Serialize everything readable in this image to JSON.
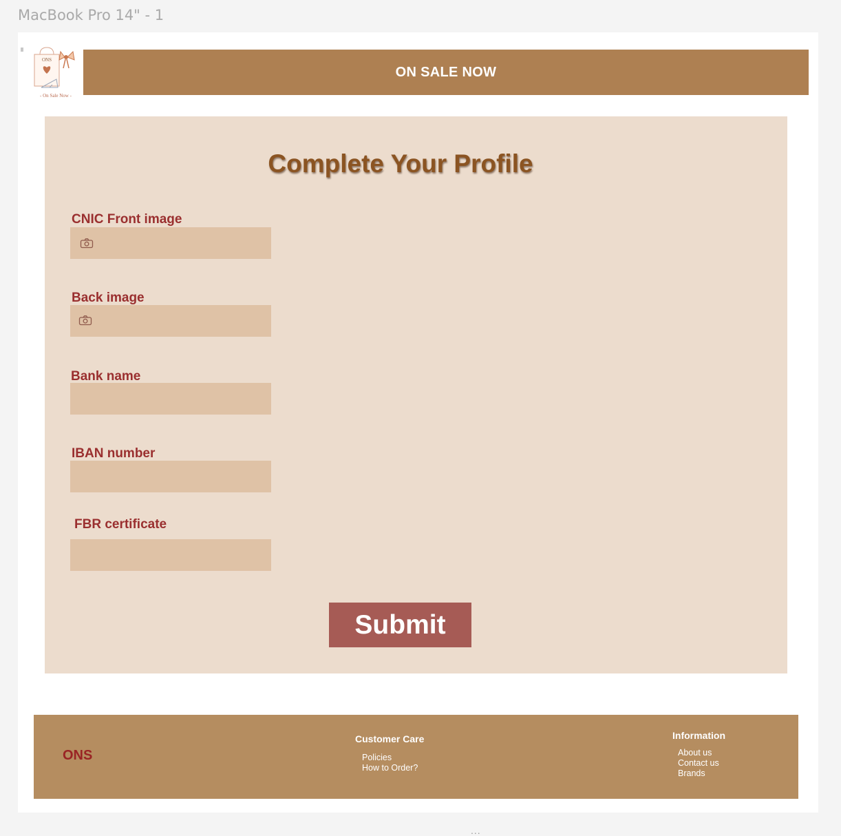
{
  "frame": {
    "title": "MacBook Pro 14\" - 1"
  },
  "logo": {
    "monogram": "ONS",
    "caption": "- On Sale Now -"
  },
  "banner": {
    "text": "ON SALE NOW"
  },
  "form": {
    "title": "Complete Your Profile",
    "fields": [
      {
        "label": "CNIC Front image",
        "icon": "camera-icon"
      },
      {
        "label": "Back image",
        "icon": "camera-icon"
      },
      {
        "label": "Bank name"
      },
      {
        "label": "IBAN number"
      },
      {
        "label": "FBR certificate"
      }
    ],
    "submit_label": "Submit"
  },
  "footer": {
    "brand": "ONS",
    "customer_care": {
      "heading": "Customer Care",
      "links": [
        "Policies",
        "How to Order?"
      ]
    },
    "information": {
      "heading": "Information",
      "links": [
        "About us",
        "Contact us",
        "Brands"
      ]
    }
  },
  "canvas": {
    "more_indicator": "..."
  },
  "colors": {
    "banner": "#ae8052",
    "card": "#ecdccd",
    "field": "#dfc2a6",
    "label": "#9a2f2f",
    "title": "#8b5422",
    "submit": "#a65b55",
    "footer": "#b58d60"
  }
}
